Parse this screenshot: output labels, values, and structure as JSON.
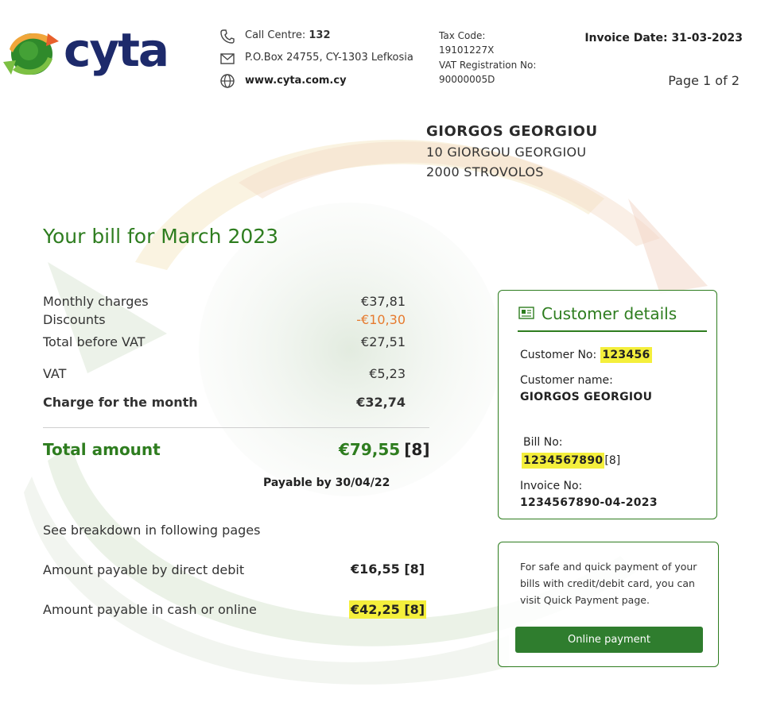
{
  "logo": {
    "text": "cyta"
  },
  "header": {
    "call_centre_label": "Call Centre:",
    "call_centre_number": "132",
    "po_box": "P.O.Box 24755, CY-1303 Lefkosia",
    "website": "www.cyta.com.cy",
    "tax_code_label": "Tax Code:",
    "tax_code": "19101227X",
    "vat_reg_label": "VAT Registration No:",
    "vat_reg": "90000005D",
    "invoice_date": "Invoice Date: 31-03-2023",
    "page": "Page 1 of 2"
  },
  "address": {
    "name": "GIORGOS GEORGIOU",
    "line1": "10 GIORGOU GEORGIOU",
    "line2": "2000 STROVOLOS"
  },
  "bill": {
    "title": "Your bill for March 2023",
    "rows": [
      {
        "label": "Monthly charges",
        "value": "€37,81"
      },
      {
        "label": "Discounts",
        "value": "-€10,30"
      },
      {
        "label": "Total before VAT",
        "value": "€27,51"
      },
      {
        "label": "VAT",
        "value": "€5,23"
      },
      {
        "label": "Charge for the month",
        "value": "€32,74"
      }
    ],
    "total_label": "Total amount",
    "total_value": "€79,55",
    "total_ref": "[8]",
    "payable_by": "Payable by 30/04/22",
    "breakdown_note": "See breakdown in following pages",
    "direct_debit_label": "Amount payable by direct debit",
    "direct_debit_value": "€16,55 [8]",
    "cash_label": "Amount payable in cash or online",
    "cash_value": "€42,25 [8]"
  },
  "customer": {
    "title": "Customer details",
    "customer_no_label": "Customer No:",
    "customer_no": "123456",
    "customer_name_label": "Customer name:",
    "customer_name": "GIORGOS GEORGIOU",
    "bill_no_label": "Bill No:",
    "bill_no": "1234567890",
    "bill_no_ref": "[8]",
    "invoice_no_label": "Invoice No:",
    "invoice_no": "1234567890-04-2023"
  },
  "payment": {
    "text_line1": "For safe and quick payment of your",
    "text_line2": "bills with credit/debit card, you can",
    "text_line3": "visit Quick Payment page.",
    "button_label": "Online payment"
  },
  "colors": {
    "brand_green": "#2e7d1f",
    "brand_navy": "#1d2a6b",
    "highlight": "#f4ef3c",
    "discount_orange": "#e67a2e"
  }
}
